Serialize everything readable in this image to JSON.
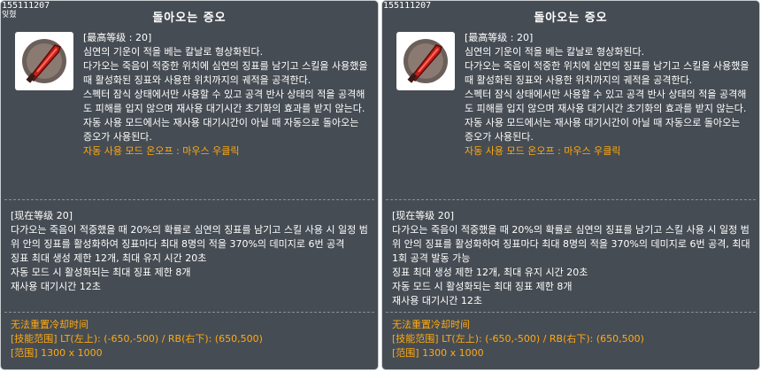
{
  "tooltips": [
    {
      "skill_id": "155111207",
      "extra_tag": "잊혔",
      "title": "돌아오는 증오",
      "max_level": "[最高等级 : 20]",
      "description": [
        "심연의 기운이 적을 베는 칼날로 형상화된다.",
        "다가오는 죽음이 적중한 위치에 심연의 징표를 남기고 스킬을 사용했을 때 활성화된 징표와 사용한 위치까지의 궤적을 공격한다.",
        "스펙터 잠식 상태에서만 사용할 수 있고 공격 반사 상태의 적을 공격해도 피해를 입지 않으며 재사용 대기시간 초기화의 효과를 받지 않는다.",
        "자동 사용 모드에서는 재사용 대기시간이 아닐 때 자동으로 돌아오는 증오가 사용된다."
      ],
      "auto_mode": "자동 사용 모드 온오프 : 마우스 우클릭",
      "current_level": "[现在等级 20]",
      "level_lines": [
        "다가오는 죽음이 적중했을 때 20%의 확률로 심연의 징표를 남기고 스킬 사용 시 일정 범위 안의 징표를 활성화하여 징표마다 최대 8명의 적을 370%의 데미지로 6번 공격",
        "징표 최대 생성 제한 12개, 최대 유지 시간 20초",
        "자동 모드 시 활성화되는 최대 징표 제한 8개",
        "재사용 대기시간 12초"
      ],
      "extra_lines": [
        "无法重置冷却时间",
        "[技能范围] LT(左上): (-650,-500) / RB(右下): (650,500)",
        "[范围] 1300 x 1000"
      ]
    },
    {
      "skill_id": "155111207",
      "title": "돌아오는 증오",
      "max_level": "[最高等级 : 20]",
      "description": [
        "심연의 기운이 적을 베는 칼날로 형상화된다.",
        "다가오는 죽음이 적중한 위치에 심연의 징표를 남기고 스킬을 사용했을 때 활성화된 징표와 사용한 위치까지의 궤적을 공격한다.",
        "스펙터 잠식 상태에서만 사용할 수 있고 공격 반사 상태의 적을 공격해도 피해를 입지 않으며 재사용 대기시간 초기화의 효과를 받지 않는다.",
        "자동 사용 모드에서는 재사용 대기시간이 아닐 때 자동으로 돌아오는 증오가 사용된다."
      ],
      "auto_mode": "자동 사용 모드 온오프 : 마우스 우클릭",
      "current_level": "[现在等级 20]",
      "level_lines": [
        "다가오는 죽음이 적중했을 때 20%의 확률로 심연의 징표를 남기고 스킬 사용 시 일정 범위 안의 징표를 활성화하여 징표마다 최대 8명의 적을 370%의 데미지로 6번 공격, 최대 1회 공격 발동 가능",
        "징표 최대 생성 제한 12개, 최대 유지 시간 20초",
        "자동 모드 시 활성화되는 최대 징표 제한 8개",
        "재사용 대기시간 12초"
      ],
      "extra_lines": [
        "无法重置冷却时间",
        "[技能范围] LT(左上): (-650,-500) / RB(右下): (650,500)",
        "[范围] 1300 x 1000"
      ]
    }
  ],
  "colors": {
    "panel_bg": "#464c53",
    "panel_border": "#c9ced3",
    "text": "#ffffff",
    "highlight": "#ffaa11",
    "icon_blade": "#c8201c"
  },
  "icon": "red-blade-skill-icon"
}
